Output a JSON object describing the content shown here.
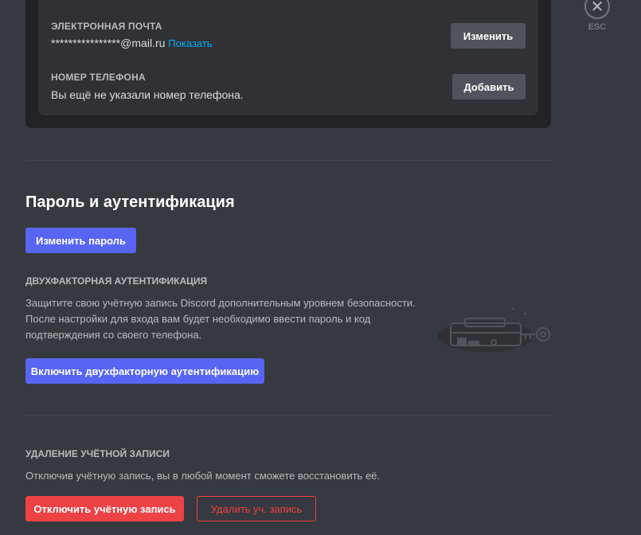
{
  "account": {
    "email_label": "Электронная почта",
    "email_value": "****************@mail.ru",
    "email_reveal": "Показать",
    "email_button": "Изменить",
    "phone_label": "Номер телефона",
    "phone_value": "Вы ещё не указали номер телефона.",
    "phone_button": "Добавить"
  },
  "close": {
    "esc_label": "ESC"
  },
  "password_section": {
    "title": "Пароль и аутентификация",
    "change_password_button": "Изменить пароль",
    "twofa_heading": "Двухфакторная аутентификация",
    "twofa_desc_line1": "Защитите свою учётную запись Discord дополнительным уровнем безопасности.",
    "twofa_desc_line2": "После настройки для входа вам будет необходимо ввести пароль и код",
    "twofa_desc_line3": "подтверждения со своего телефона.",
    "twofa_button": "Включить двухфакторную аутентификацию"
  },
  "deletion_section": {
    "heading": "Удаление учётной записи",
    "description": "Отключив учётную запись, вы в любой момент сможете восстановить её.",
    "disable_button": "Отключить учётную запись",
    "delete_button": "Удалить уч. запись"
  },
  "colors": {
    "background": "#36393f",
    "card": "#2f3136",
    "blurple": "#5865f2",
    "danger": "#ed4245",
    "link": "#00b0f4"
  }
}
